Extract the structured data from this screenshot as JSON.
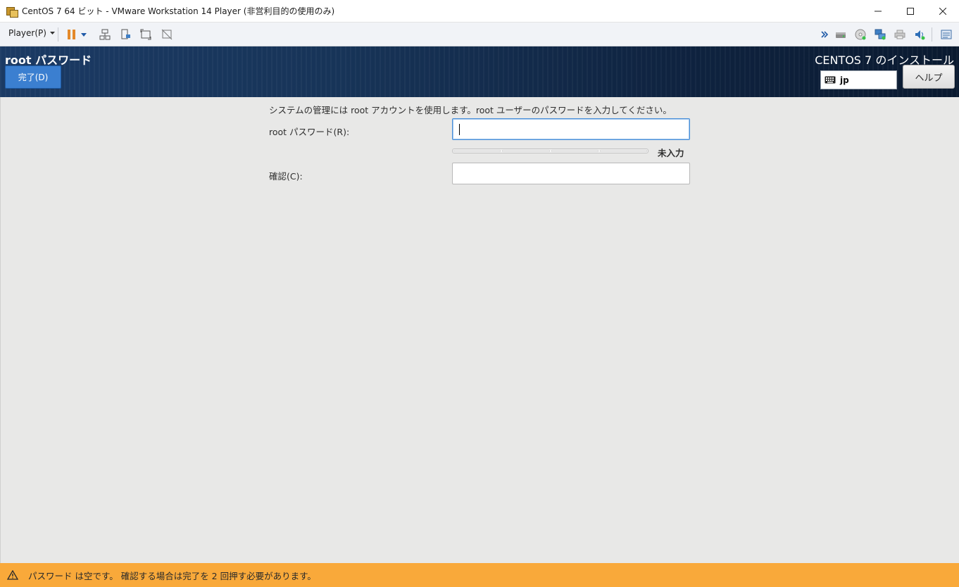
{
  "window": {
    "title": "CentOS 7 64 ビット - VMware Workstation 14 Player (非営利目的の使用のみ)"
  },
  "toolbar": {
    "player_menu_label": "Player(P)"
  },
  "header": {
    "page_title": "root パスワード",
    "done_label": "完了(D)",
    "install_title": "CENTOS 7 のインストール",
    "keyboard_layout": "jp",
    "help_label": "ヘルプ"
  },
  "form": {
    "description": "システムの管理には root アカウントを使用します。root ユーザーのパスワードを入力してください。",
    "password_label": "root パスワード(R):",
    "password_value": "",
    "strength_label": "未入力",
    "strength_level": 0,
    "confirm_label": "確認(C):",
    "confirm_value": ""
  },
  "warning": {
    "text": "パスワード は空です。 確認する場合は完了を 2 回押す必要があります。"
  },
  "colors": {
    "done_button": "#3b7fd0",
    "warning_bar": "#f9a93a",
    "header_bg": "#173458"
  }
}
